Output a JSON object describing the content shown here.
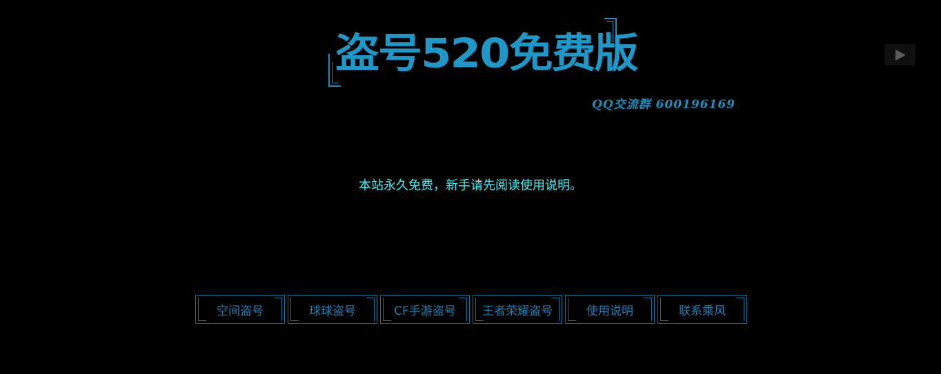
{
  "logo": {
    "title": "盗号520免费版"
  },
  "header": {
    "qq_group": "QQ交流群 600196169"
  },
  "notice": {
    "text": "本站永久免费，新手请先阅读使用说明。"
  },
  "nav": {
    "items": [
      {
        "label": "空间盗号"
      },
      {
        "label": "球球盗号"
      },
      {
        "label": "CF手游盗号"
      },
      {
        "label": "王者荣耀盗号"
      },
      {
        "label": "使用说明"
      },
      {
        "label": "联系乘风"
      }
    ]
  },
  "media": {
    "play_icon": "play-icon"
  },
  "colors": {
    "background": "#000000",
    "logo": "#1e98c8",
    "notice": "#3ff0f6",
    "nav_text": "#1f7fb5",
    "nav_border": "#1a6f95"
  }
}
